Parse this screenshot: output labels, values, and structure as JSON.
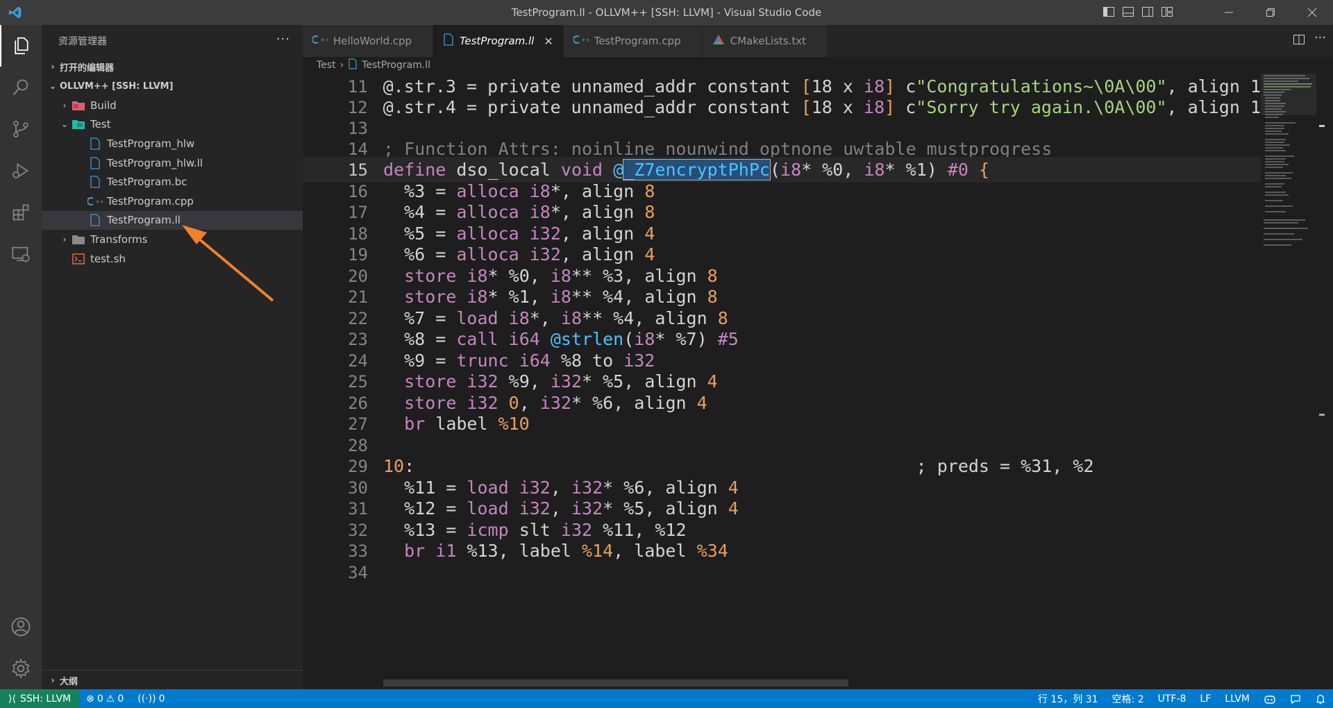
{
  "window": {
    "title": "TestProgram.ll - OLLVM++ [SSH: LLVM] - Visual Studio Code"
  },
  "sidebar": {
    "title": "资源管理器",
    "more": "···",
    "open_editors": "打开的编辑器",
    "workspace": "OLLVM++ [SSH: LLVM]",
    "outline": "大纲",
    "tree": [
      {
        "label": "Build",
        "icon": "folder-red-icon",
        "chev": "›",
        "level": 1
      },
      {
        "label": "Test",
        "icon": "folder-green-icon",
        "chev": "⌄",
        "level": 1
      },
      {
        "label": "TestProgram_hlw",
        "icon": "file-icon",
        "level": 2
      },
      {
        "label": "TestProgram_hlw.ll",
        "icon": "file-icon",
        "level": 2
      },
      {
        "label": "TestProgram.bc",
        "icon": "file-icon",
        "level": 2
      },
      {
        "label": "TestProgram.cpp",
        "icon": "cpp-icon",
        "level": 2
      },
      {
        "label": "TestProgram.ll",
        "icon": "file-icon",
        "level": 2,
        "selected": true
      },
      {
        "label": "Transforms",
        "icon": "folder-icon",
        "chev": "›",
        "level": 1
      },
      {
        "label": "test.sh",
        "icon": "shell-icon",
        "level": 1
      }
    ]
  },
  "tabs": [
    {
      "label": "HelloWorld.cpp",
      "icon": "cpp-icon"
    },
    {
      "label": "TestProgram.ll",
      "icon": "file-icon",
      "active": true
    },
    {
      "label": "TestProgram.cpp",
      "icon": "cpp-icon"
    },
    {
      "label": "CMakeLists.txt",
      "icon": "cmake-icon"
    }
  ],
  "breadcrumb": {
    "folder": "Test",
    "file": "TestProgram.ll"
  },
  "editor": {
    "current_line": 15,
    "lines": [
      {
        "n": "11"
      },
      {
        "n": "12"
      },
      {
        "n": "13"
      },
      {
        "n": "14"
      },
      {
        "n": "15"
      },
      {
        "n": "16"
      },
      {
        "n": "17"
      },
      {
        "n": "18"
      },
      {
        "n": "19"
      },
      {
        "n": "20"
      },
      {
        "n": "21"
      },
      {
        "n": "22"
      },
      {
        "n": "23"
      },
      {
        "n": "24"
      },
      {
        "n": "25"
      },
      {
        "n": "26"
      },
      {
        "n": "27"
      },
      {
        "n": "28"
      },
      {
        "n": "29"
      },
      {
        "n": "30"
      },
      {
        "n": "31"
      },
      {
        "n": "32"
      },
      {
        "n": "33"
      },
      {
        "n": "34"
      }
    ]
  },
  "status": {
    "remote": "SSH: LLVM",
    "errors": "0",
    "warnings": "0",
    "ports": "0",
    "position": "行 15，列 31",
    "spaces": "空格: 2",
    "encoding": "UTF-8",
    "eol": "LF",
    "language": "LLVM"
  },
  "colors": {
    "statusbar": "#007acc",
    "remote": "#16825d",
    "arrow": "#f0812c"
  }
}
